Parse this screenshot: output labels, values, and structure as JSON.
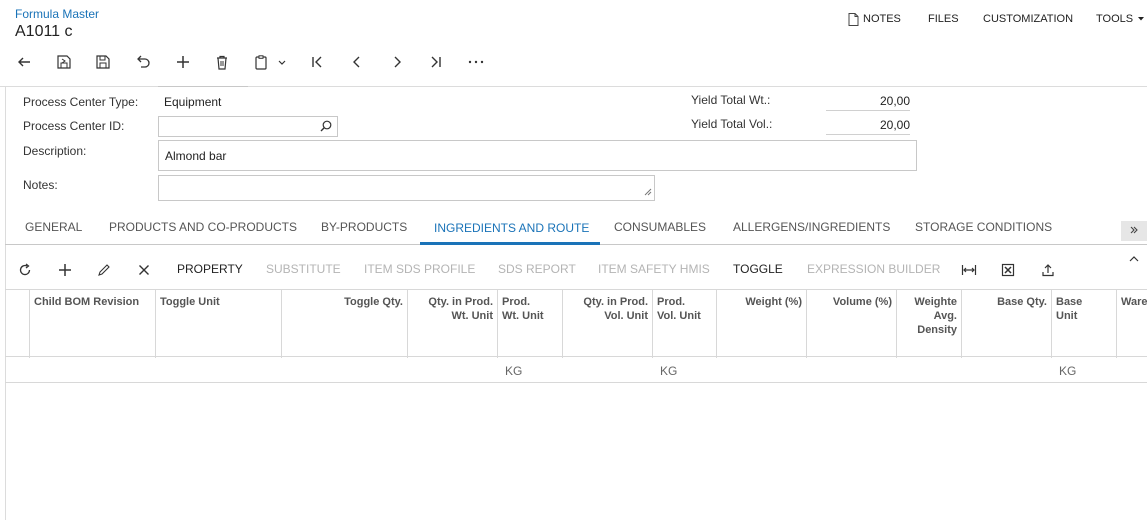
{
  "breadcrumb": "Formula Master",
  "title": "A1011 c",
  "topmenu": {
    "notes": "NOTES",
    "files": "FILES",
    "customization": "CUSTOMIZATION",
    "tools": "TOOLS"
  },
  "form": {
    "process_center_type_label": "Process Center Type:",
    "process_center_type_value": "Equipment",
    "process_center_id_label": "Process Center ID:",
    "process_center_id_value": "",
    "description_label": "Description:",
    "description_value": "Almond bar",
    "notes_label": "Notes:",
    "notes_value": "",
    "yield_total_wt_label": "Yield Total Wt.:",
    "yield_total_wt_value": "20,00",
    "yield_total_vol_label": "Yield Total Vol.:",
    "yield_total_vol_value": "20,00"
  },
  "tabs": [
    "GENERAL",
    "PRODUCTS AND CO-PRODUCTS",
    "BY-PRODUCTS",
    "INGREDIENTS AND ROUTE",
    "CONSUMABLES",
    "ALLERGENS/INGREDIENTS",
    "STORAGE CONDITIONS"
  ],
  "active_tab": "INGREDIENTS AND ROUTE",
  "grid_toolbar": {
    "property": "PROPERTY",
    "substitute": "SUBSTITUTE",
    "item_sds_profile": "ITEM SDS PROFILE",
    "sds_report": "SDS REPORT",
    "item_safety_hmis": "ITEM SAFETY HMIS",
    "toggle": "TOGGLE",
    "expression_builder": "EXPRESSION BUILDER"
  },
  "columns": {
    "child_bom_revision": "Child BOM Revision",
    "toggle_unit": "Toggle Unit",
    "toggle_qty": "Toggle Qty.",
    "qty_prod_wt_unit_1": "Qty. in Prod.",
    "qty_prod_wt_unit_2": "Wt. Unit",
    "prod_wt_unit_1": "Prod.",
    "prod_wt_unit_2": "Wt. Unit",
    "qty_prod_vol_unit_1": "Qty. in Prod.",
    "qty_prod_vol_unit_2": "Vol. Unit",
    "prod_vol_unit_1": "Prod.",
    "prod_vol_unit_2": "Vol. Unit",
    "weight_pct": "Weight (%)",
    "volume_pct": "Volume (%)",
    "weighted_1": "Weighte",
    "weighted_2": "Avg.",
    "weighted_3": "Density",
    "base_qty": "Base Qty.",
    "base_unit_1": "Base",
    "base_unit_2": "Unit",
    "warehouse": "Ware"
  },
  "row": {
    "prod_wt_unit": "KG",
    "prod_vol_unit": "KG",
    "base_unit": "KG"
  },
  "colors": {
    "accent": "#1a73b8",
    "disabled": "#b4b4b4"
  }
}
